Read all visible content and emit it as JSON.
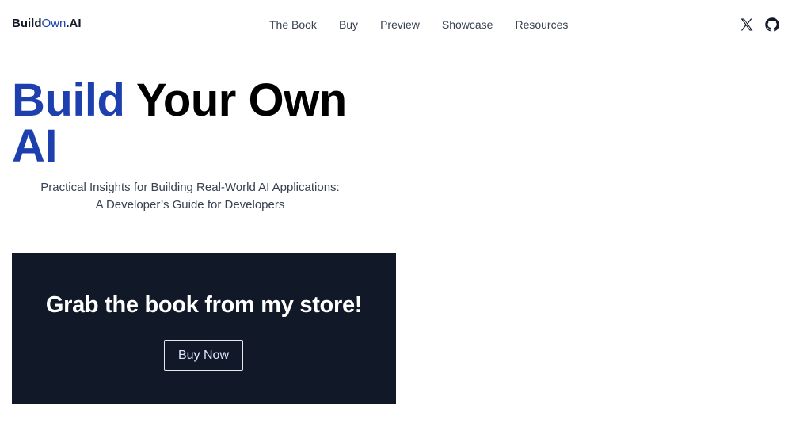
{
  "header": {
    "logo": {
      "part1": "Build",
      "part2": "Own",
      "part3": ".AI"
    },
    "nav": [
      "The Book",
      "Buy",
      "Preview",
      "Showcase",
      "Resources"
    ],
    "icons": [
      "x-twitter-icon",
      "github-icon"
    ]
  },
  "hero": {
    "title_blue": "Build",
    "title_rest": " Your Own",
    "title_blue2": "AI",
    "subtitle_line1": "Practical Insights for Building Real-World AI Applications:",
    "subtitle_line2": "A Developer’s Guide for Developers"
  },
  "store": {
    "title": "Grab the book from my store!",
    "button_label": "Buy Now"
  },
  "colors": {
    "accent": "#1e40af",
    "panel_bg": "#111827",
    "text": "#111827"
  }
}
